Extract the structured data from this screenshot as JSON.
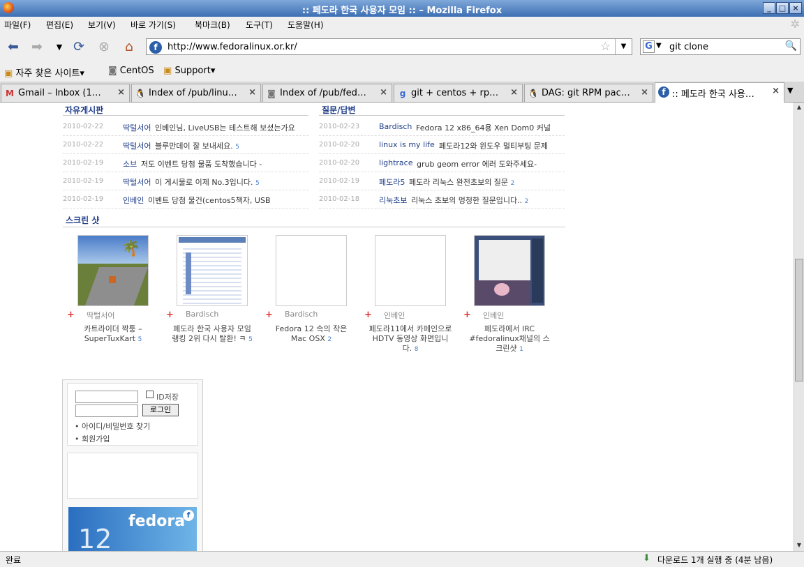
{
  "window": {
    "title": ":: 페도라 한국 사용자 모임 :: – Mozilla Firefox",
    "buttons": [
      "_",
      "□",
      "×"
    ]
  },
  "menu": [
    "파일(F)",
    "편집(E)",
    "보기(V)",
    "바로 가기(S)",
    "북마크(B)",
    "도구(T)",
    "도움말(H)"
  ],
  "nav": {
    "url": "http://www.fedoralinux.or.kr/",
    "search_query": "git clone",
    "search_engine_icon": "G"
  },
  "bookmarks": [
    "자주 찾은 사이트▾",
    "CentOS",
    "Support▾"
  ],
  "tabs": [
    {
      "label": "Gmail – Inbox (1…",
      "icon": "gmail-icon"
    },
    {
      "label": "Index of /pub/linu…",
      "icon": "tux-icon"
    },
    {
      "label": "Index of /pub/fed…",
      "icon": "page-icon"
    },
    {
      "label": "git + centos + rp…",
      "icon": "google-icon"
    },
    {
      "label": "DAG: git RPM pac…",
      "icon": "tux-icon"
    },
    {
      "label": ":: 페도라 한국 사용…",
      "icon": "fedora-icon"
    }
  ],
  "free_board": {
    "title": "자유게시판",
    "rows": [
      {
        "date": "2010-02-22",
        "user": "딱털서어",
        "text": "인베인님, LiveUSB는 테스트해 보셨는가요",
        "comments": ""
      },
      {
        "date": "2010-02-22",
        "user": "딱털서어",
        "text": "블루만데이 잘 보내세요.",
        "comments": "5"
      },
      {
        "date": "2010-02-19",
        "user": "소브",
        "text": "저도 이벤트 당첨 물품 도착했습니다 -",
        "comments": ""
      },
      {
        "date": "2010-02-19",
        "user": "딱털서어",
        "text": "이 게시물로 이제 No.3입니다.",
        "comments": "5"
      },
      {
        "date": "2010-02-19",
        "user": "인베인",
        "text": "이벤트 당첨 물건(centos5책자, USB",
        "comments": ""
      }
    ]
  },
  "qa_board": {
    "title": "질문/답변",
    "rows": [
      {
        "date": "2010-02-23",
        "user": "Bardisch",
        "text": "Fedora 12 x86_64용 Xen Dom0 커널",
        "comments": ""
      },
      {
        "date": "2010-02-20",
        "user": "linux is my life",
        "text": "페도라12와 윈도우 멀티부팅 문제",
        "comments": ""
      },
      {
        "date": "2010-02-20",
        "user": "lightrace",
        "text": "grub geom error 에러 도와주세요-",
        "comments": ""
      },
      {
        "date": "2010-02-19",
        "user": "페도라5",
        "text": "페도라 리눅스 완전초보의 질문",
        "comments": "2"
      },
      {
        "date": "2010-02-18",
        "user": "리눅초보",
        "text": "리눅스 초보의 멍청한 질문입니다..",
        "comments": "2"
      }
    ]
  },
  "screenshots": {
    "title": "스크린 샷",
    "items": [
      {
        "author": "딱털서어",
        "caption": "카트라이더 짝퉁 – SuperTuxKart",
        "comments": "5"
      },
      {
        "author": "Bardisch",
        "caption": "페도라 한국 사용자 모임 랭킹 2위 다시 탈환! ㅋ",
        "comments": "5"
      },
      {
        "author": "Bardisch",
        "caption": "Fedora 12 속의 작은 Mac OSX",
        "comments": "2"
      },
      {
        "author": "인베인",
        "caption": "페도라11에서 카페인으로 HDTV 동영상 화면입니다.",
        "comments": "8"
      },
      {
        "author": "인베인",
        "caption": "페도라에서 IRC #fedoralinux채널의 스크린샷",
        "comments": "1"
      }
    ]
  },
  "login": {
    "remember_label": "ID저장",
    "login_button": "로그인",
    "find_link": "아이디/비밀번호 찾기",
    "join_link": "회원가입"
  },
  "banner": {
    "brand": "fedora",
    "version": "12"
  },
  "status": {
    "left": "완료",
    "right": "다운로드 1개 실행 중 (4분 남음)"
  }
}
